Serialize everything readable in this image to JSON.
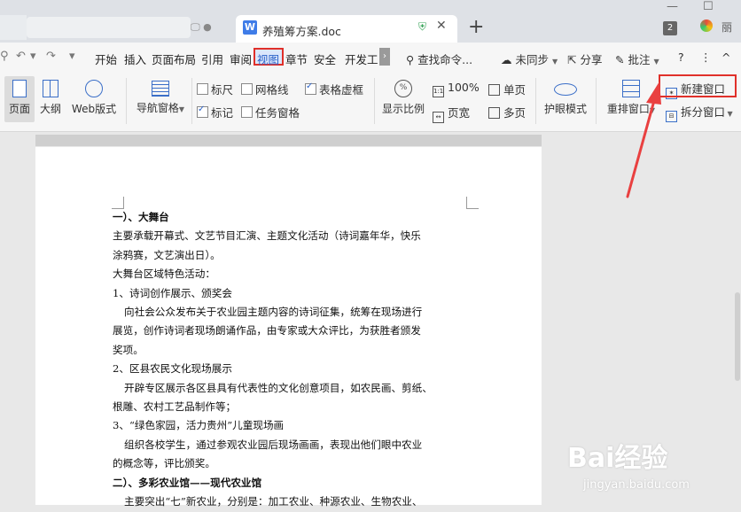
{
  "tabs": {
    "active_tab": {
      "title": "养殖筹方案.doc",
      "badge": "W"
    },
    "new_tab_symbol": "+"
  },
  "window": {
    "badge_count": "2",
    "user_initial": "丽"
  },
  "menu": {
    "items": [
      "开始",
      "插入",
      "页面布局",
      "引用",
      "审阅",
      "视图",
      "章节",
      "安全",
      "开发工"
    ],
    "search": "查找命令...",
    "sync": "未同步",
    "share": "分享",
    "comment": "批注",
    "help": "?",
    "more": "⋮"
  },
  "ribbon": {
    "views": [
      "页面",
      "大纲",
      "Web版式"
    ],
    "nav_pane": "导航窗格",
    "checkboxes": [
      {
        "label": "标尺",
        "checked": false
      },
      {
        "label": "网格线",
        "checked": false
      },
      {
        "label": "表格虚框",
        "checked": true
      },
      {
        "label": "标记",
        "checked": true
      },
      {
        "label": "任务窗格",
        "checked": false
      }
    ],
    "zoom": "显示比例",
    "zoom_100": "100%",
    "single_page": "单页",
    "page_width": "页宽",
    "multi_page": "多页",
    "eye_mode": "护眼模式",
    "rearrange": "重排窗口",
    "new_window": "新建窗口",
    "split_window": "拆分窗口"
  },
  "document": {
    "lines": [
      {
        "text": "一）、大舞台",
        "style": "bold"
      },
      {
        "text": "主要承载开幕式、文艺节目汇演、主题文化活动（诗词嘉年华，快乐",
        "style": "normal"
      },
      {
        "text": "涂鸦赛，文艺演出日）。",
        "style": "normal"
      },
      {
        "text": "大舞台区域特色活动：",
        "style": "normal"
      },
      {
        "text": "1、诗词创作展示、颁奖会",
        "style": "normal"
      },
      {
        "text": "向社会公众发布关于农业园主题内容的诗词征集，统筹在现场进行",
        "style": "indent"
      },
      {
        "text": "展览，创作诗词者现场朗诵作品，由专家或大众评比，为获胜者颁发",
        "style": "normal"
      },
      {
        "text": "奖项。",
        "style": "normal"
      },
      {
        "text": "2、区县农民文化现场展示",
        "style": "normal"
      },
      {
        "text": "开辟专区展示各区县具有代表性的文化创意项目，如农民画、剪纸、",
        "style": "indent"
      },
      {
        "text": "根雕、农村工艺品制作等；",
        "style": "normal"
      },
      {
        "text": "3、“绿色家园，活力贵州”儿童现场画",
        "style": "normal"
      },
      {
        "text": "组织各校学生，通过参观农业园后现场画画，表现出他们眼中农业",
        "style": "indent"
      },
      {
        "text": "的概念等，评比颁奖。",
        "style": "normal"
      },
      {
        "text": "二）、多彩农业馆——现代农业馆",
        "style": "bold"
      },
      {
        "text": "主要突出“七”新农业，分别是：加工农业、种源农业、生物农业、",
        "style": "indent"
      }
    ]
  },
  "watermark": {
    "logo": "Bai经验",
    "url": "jingyan.baidu.com"
  }
}
